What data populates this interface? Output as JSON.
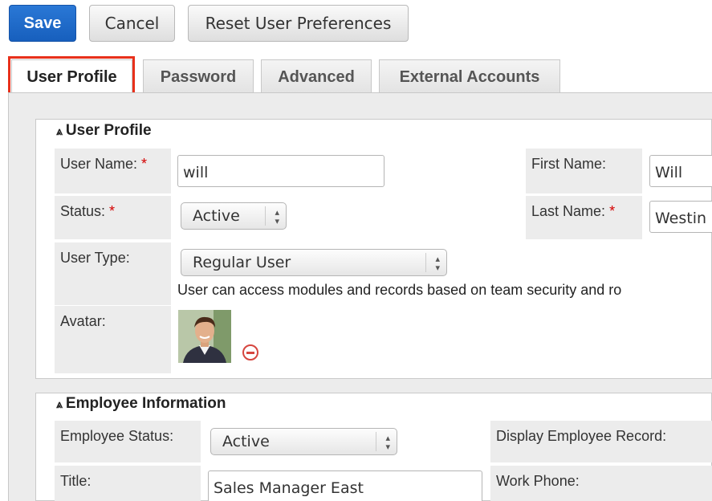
{
  "toolbar": {
    "save_label": "Save",
    "cancel_label": "Cancel",
    "reset_label": "Reset User Preferences"
  },
  "tabs": [
    {
      "label": "User Profile"
    },
    {
      "label": "Password"
    },
    {
      "label": "Advanced"
    },
    {
      "label": "External Accounts"
    }
  ],
  "user_profile": {
    "title": "User Profile",
    "user_name_label": "User Name:",
    "user_name_value": "will",
    "first_name_label": "First Name:",
    "first_name_value": "Will",
    "status_label": "Status:",
    "status_value": "Active",
    "last_name_label": "Last Name:",
    "last_name_value": "Westin",
    "user_type_label": "User Type:",
    "user_type_value": "Regular User",
    "user_type_desc": "User can access modules and records based on team security and ro",
    "avatar_label": "Avatar:",
    "required_mark": "*"
  },
  "employee_info": {
    "title": "Employee Information",
    "employee_status_label": "Employee Status:",
    "employee_status_value": "Active",
    "display_record_label": "Display Employee Record:",
    "title_label": "Title:",
    "title_value": "Sales Manager East",
    "work_phone_label": "Work Phone:"
  },
  "colors": {
    "primary_button": "#1f6cc9",
    "highlight_box": "#e8301b",
    "required_star": "#d40000",
    "remove_icon": "#d6463f"
  }
}
